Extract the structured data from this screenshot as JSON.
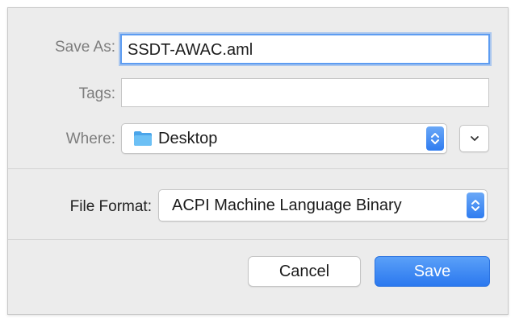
{
  "dialog": {
    "save_as_label": "Save As:",
    "save_as_value": "SSDT-AWAC.aml",
    "tags_label": "Tags:",
    "tags_value": "",
    "where_label": "Where:",
    "where_value": "Desktop",
    "file_format_label": "File Format:",
    "file_format_value": "ACPI Machine Language Binary",
    "cancel_label": "Cancel",
    "save_label": "Save"
  },
  "colors": {
    "accent": "#2f7cf0",
    "focus_ring": "#5d9cf1",
    "folder": "#5fb2f0"
  },
  "icons": {
    "folder": "folder-icon",
    "stepper": "chevron-up-down-icon",
    "expand": "chevron-down-icon"
  }
}
